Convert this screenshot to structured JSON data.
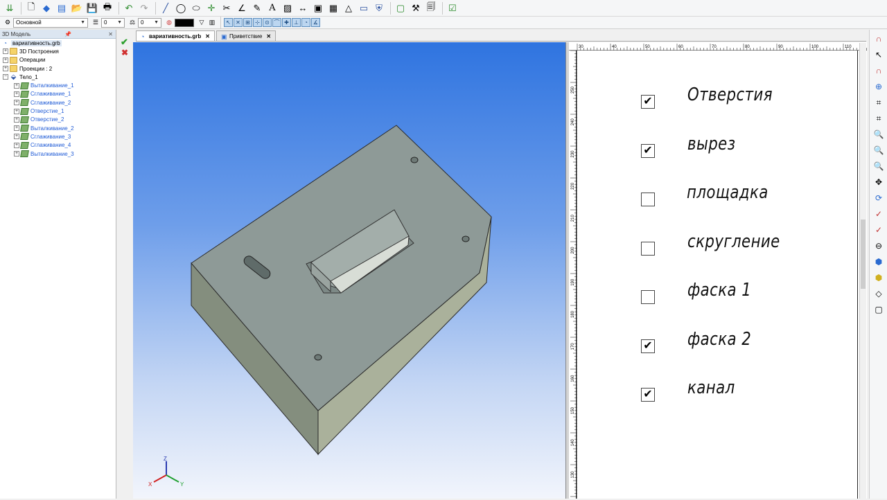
{
  "colors": {
    "toolbar_bg": "#f5f6f7",
    "tree_link": "#1f5bd6",
    "viewport_top": "#2f74e0",
    "viewport_bottom": "#f2f5fc",
    "part_top": "#8d9b97",
    "part_front": "#a3ab94",
    "part_side": "#7f8a7a",
    "ok_green": "#2ea02e",
    "cancel_red": "#d03030"
  },
  "toolbar": {
    "style_combo": "Основной",
    "layer_combo": "0",
    "weight_combo": "0"
  },
  "tree": {
    "header": "3D Модель",
    "root": "вариативность.grb",
    "items": [
      {
        "label": "3D Построения",
        "kind": "folder"
      },
      {
        "label": "Операции",
        "kind": "folder"
      },
      {
        "label": "Проекции : 2",
        "kind": "folder"
      },
      {
        "label": "Тело_1",
        "kind": "body"
      },
      {
        "label": "Выталкивание_1",
        "kind": "op"
      },
      {
        "label": "Сглаживание_1",
        "kind": "op"
      },
      {
        "label": "Сглаживание_2",
        "kind": "op"
      },
      {
        "label": "Отверстие_1",
        "kind": "op"
      },
      {
        "label": "Отверстие_2",
        "kind": "op"
      },
      {
        "label": "Выталкивание_2",
        "kind": "op"
      },
      {
        "label": "Сглаживание_3",
        "kind": "op"
      },
      {
        "label": "Сглаживание_4",
        "kind": "op"
      },
      {
        "label": "Выталкивание_3",
        "kind": "op"
      }
    ]
  },
  "tabs": [
    {
      "label": "вариативность.grb",
      "active": true
    },
    {
      "label": "Приветствие",
      "active": false
    }
  ],
  "ruler": {
    "top_ticks": [
      "30",
      "40",
      "50",
      "60",
      "70",
      "80",
      "90",
      "100",
      "110"
    ],
    "left_ticks": [
      "250",
      "240",
      "230",
      "220",
      "210",
      "200",
      "190",
      "180",
      "170",
      "160",
      "150",
      "140",
      "130"
    ]
  },
  "axes": {
    "x": "X",
    "y": "Y",
    "z": "Z"
  },
  "options": [
    {
      "label": "Отверстия",
      "checked": true
    },
    {
      "label": "вырез",
      "checked": true
    },
    {
      "label": "площадка",
      "checked": false
    },
    {
      "label": "скругление",
      "checked": false
    },
    {
      "label": "фаска 1",
      "checked": false
    },
    {
      "label": "фаска 2",
      "checked": true
    },
    {
      "label": "канал",
      "checked": true
    }
  ]
}
